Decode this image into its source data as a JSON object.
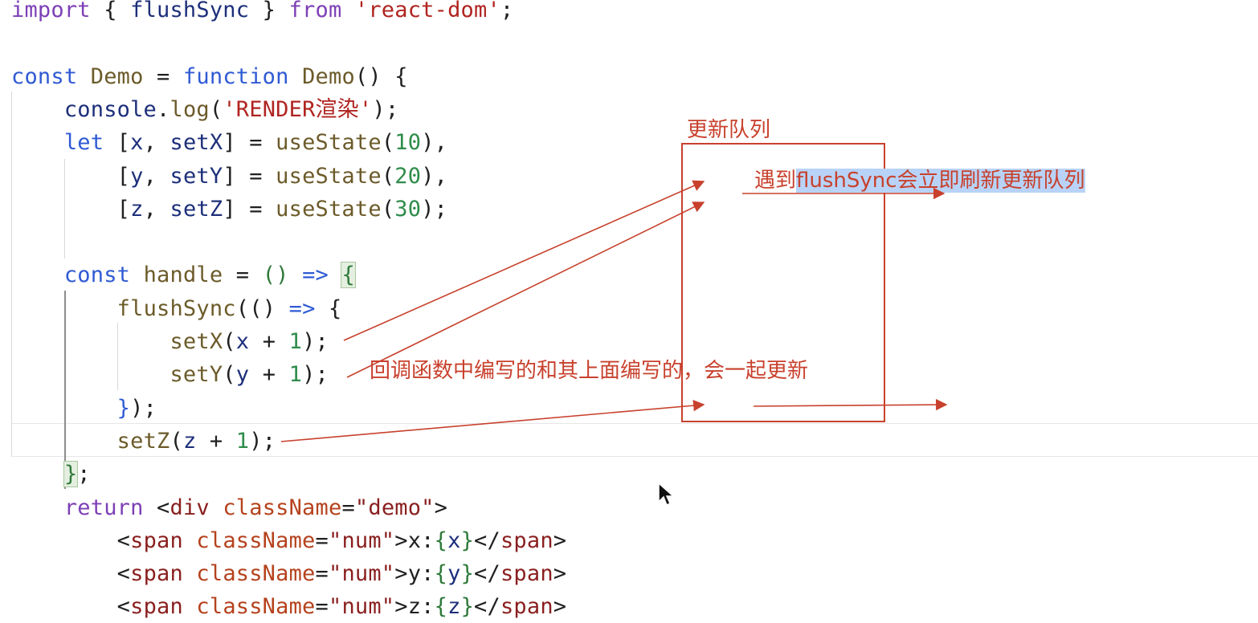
{
  "editor": {
    "lines": [
      {
        "tokens": [
          {
            "t": "import",
            "c": "kw2"
          },
          {
            "t": " { ",
            "c": "punc"
          },
          {
            "t": "flushSync",
            "c": "var"
          },
          {
            "t": " } ",
            "c": "punc"
          },
          {
            "t": "from",
            "c": "kw2"
          },
          {
            "t": " ",
            "c": "punc"
          },
          {
            "t": "'react-dom'",
            "c": "str"
          },
          {
            "t": ";",
            "c": "punc"
          }
        ]
      },
      {
        "tokens": []
      },
      {
        "tokens": [
          {
            "t": "const",
            "c": "kw"
          },
          {
            "t": " ",
            "c": "punc"
          },
          {
            "t": "Demo",
            "c": "fn"
          },
          {
            "t": " = ",
            "c": "punc"
          },
          {
            "t": "function",
            "c": "kw"
          },
          {
            "t": " ",
            "c": "punc"
          },
          {
            "t": "Demo",
            "c": "fn"
          },
          {
            "t": "() {",
            "c": "punc"
          }
        ]
      },
      {
        "tokens": [
          {
            "t": "    ",
            "c": "punc"
          },
          {
            "t": "console",
            "c": "var"
          },
          {
            "t": ".",
            "c": "punc"
          },
          {
            "t": "log",
            "c": "fn"
          },
          {
            "t": "(",
            "c": "punc"
          },
          {
            "t": "'RENDER渲染'",
            "c": "str"
          },
          {
            "t": ");",
            "c": "punc"
          }
        ]
      },
      {
        "tokens": [
          {
            "t": "    ",
            "c": "punc"
          },
          {
            "t": "let",
            "c": "kw"
          },
          {
            "t": " [",
            "c": "punc"
          },
          {
            "t": "x",
            "c": "var"
          },
          {
            "t": ", ",
            "c": "punc"
          },
          {
            "t": "setX",
            "c": "var"
          },
          {
            "t": "] = ",
            "c": "punc"
          },
          {
            "t": "useState",
            "c": "fn"
          },
          {
            "t": "(",
            "c": "punc"
          },
          {
            "t": "10",
            "c": "num"
          },
          {
            "t": "),",
            "c": "punc"
          }
        ]
      },
      {
        "tokens": [
          {
            "t": "        [",
            "c": "punc"
          },
          {
            "t": "y",
            "c": "var"
          },
          {
            "t": ", ",
            "c": "punc"
          },
          {
            "t": "setY",
            "c": "var"
          },
          {
            "t": "] = ",
            "c": "punc"
          },
          {
            "t": "useState",
            "c": "fn"
          },
          {
            "t": "(",
            "c": "punc"
          },
          {
            "t": "20",
            "c": "num"
          },
          {
            "t": "),",
            "c": "punc"
          }
        ]
      },
      {
        "tokens": [
          {
            "t": "        [",
            "c": "punc"
          },
          {
            "t": "z",
            "c": "var"
          },
          {
            "t": ", ",
            "c": "punc"
          },
          {
            "t": "setZ",
            "c": "var"
          },
          {
            "t": "] = ",
            "c": "punc"
          },
          {
            "t": "useState",
            "c": "fn"
          },
          {
            "t": "(",
            "c": "punc"
          },
          {
            "t": "30",
            "c": "num"
          },
          {
            "t": ");",
            "c": "punc"
          }
        ]
      },
      {
        "tokens": []
      },
      {
        "tokens": [
          {
            "t": "    ",
            "c": "punc"
          },
          {
            "t": "const",
            "c": "kw"
          },
          {
            "t": " ",
            "c": "punc"
          },
          {
            "t": "handle",
            "c": "fn"
          },
          {
            "t": " = ",
            "c": "punc"
          },
          {
            "t": "()",
            "c": "brk"
          },
          {
            "t": " ",
            "c": "punc"
          },
          {
            "t": "=>",
            "c": "kw"
          },
          {
            "t": " ",
            "c": "punc"
          },
          {
            "t": "{",
            "c": "brk bracehl"
          }
        ]
      },
      {
        "tokens": [
          {
            "t": "        ",
            "c": "punc"
          },
          {
            "t": "flushSync",
            "c": "fn"
          },
          {
            "t": "(",
            "c": "punc"
          },
          {
            "t": "()",
            "c": "punc"
          },
          {
            "t": " ",
            "c": "punc"
          },
          {
            "t": "=>",
            "c": "kw"
          },
          {
            "t": " {",
            "c": "punc"
          }
        ]
      },
      {
        "tokens": [
          {
            "t": "            ",
            "c": "punc"
          },
          {
            "t": "setX",
            "c": "fn"
          },
          {
            "t": "(",
            "c": "punc"
          },
          {
            "t": "x",
            "c": "var"
          },
          {
            "t": " + ",
            "c": "punc"
          },
          {
            "t": "1",
            "c": "num"
          },
          {
            "t": ");",
            "c": "punc"
          }
        ]
      },
      {
        "tokens": [
          {
            "t": "            ",
            "c": "punc"
          },
          {
            "t": "setY",
            "c": "fn"
          },
          {
            "t": "(",
            "c": "punc"
          },
          {
            "t": "y",
            "c": "var"
          },
          {
            "t": " + ",
            "c": "punc"
          },
          {
            "t": "1",
            "c": "num"
          },
          {
            "t": ");",
            "c": "punc"
          }
        ]
      },
      {
        "tokens": [
          {
            "t": "        ",
            "c": "punc"
          },
          {
            "t": "}",
            "c": "kw"
          },
          {
            "t": ");",
            "c": "punc"
          }
        ]
      },
      {
        "tokens": [
          {
            "t": "        ",
            "c": "punc"
          },
          {
            "t": "setZ",
            "c": "fn"
          },
          {
            "t": "(",
            "c": "punc"
          },
          {
            "t": "z",
            "c": "var"
          },
          {
            "t": " + ",
            "c": "punc"
          },
          {
            "t": "1",
            "c": "num"
          },
          {
            "t": ");",
            "c": "punc"
          }
        ]
      },
      {
        "tokens": [
          {
            "t": "    ",
            "c": "punc"
          },
          {
            "t": "}",
            "c": "brk bracehl"
          },
          {
            "t": ";",
            "c": "punc"
          }
        ]
      },
      {
        "tokens": [
          {
            "t": "    ",
            "c": "punc"
          },
          {
            "t": "return",
            "c": "kw2"
          },
          {
            "t": " <",
            "c": "punc"
          },
          {
            "t": "div",
            "c": "tag"
          },
          {
            "t": " ",
            "c": "punc"
          },
          {
            "t": "className",
            "c": "attr"
          },
          {
            "t": "=",
            "c": "punc"
          },
          {
            "t": "\"demo\"",
            "c": "tag"
          },
          {
            "t": ">",
            "c": "punc"
          }
        ]
      },
      {
        "tokens": [
          {
            "t": "        <",
            "c": "punc"
          },
          {
            "t": "span",
            "c": "tag"
          },
          {
            "t": " ",
            "c": "punc"
          },
          {
            "t": "className",
            "c": "attr"
          },
          {
            "t": "=",
            "c": "punc"
          },
          {
            "t": "\"num\"",
            "c": "tag"
          },
          {
            "t": ">x:",
            "c": "punc"
          },
          {
            "t": "{",
            "c": "brk"
          },
          {
            "t": "x",
            "c": "var"
          },
          {
            "t": "}",
            "c": "brk"
          },
          {
            "t": "</",
            "c": "punc"
          },
          {
            "t": "span",
            "c": "tag"
          },
          {
            "t": ">",
            "c": "punc"
          }
        ]
      },
      {
        "tokens": [
          {
            "t": "        <",
            "c": "punc"
          },
          {
            "t": "span",
            "c": "tag"
          },
          {
            "t": " ",
            "c": "punc"
          },
          {
            "t": "className",
            "c": "attr"
          },
          {
            "t": "=",
            "c": "punc"
          },
          {
            "t": "\"num\"",
            "c": "tag"
          },
          {
            "t": ">y:",
            "c": "punc"
          },
          {
            "t": "{",
            "c": "brk"
          },
          {
            "t": "y",
            "c": "var"
          },
          {
            "t": "}",
            "c": "brk"
          },
          {
            "t": "</",
            "c": "punc"
          },
          {
            "t": "span",
            "c": "tag"
          },
          {
            "t": ">",
            "c": "punc"
          }
        ]
      },
      {
        "tokens": [
          {
            "t": "        <",
            "c": "punc"
          },
          {
            "t": "span",
            "c": "tag"
          },
          {
            "t": " ",
            "c": "punc"
          },
          {
            "t": "className",
            "c": "attr"
          },
          {
            "t": "=",
            "c": "punc"
          },
          {
            "t": "\"num\"",
            "c": "tag"
          },
          {
            "t": ">z:",
            "c": "punc"
          },
          {
            "t": "{",
            "c": "brk"
          },
          {
            "t": "z",
            "c": "var"
          },
          {
            "t": "}",
            "c": "brk"
          },
          {
            "t": "</",
            "c": "punc"
          },
          {
            "t": "span",
            "c": "tag"
          },
          {
            "t": ">",
            "c": "punc"
          }
        ]
      }
    ]
  },
  "annotations": {
    "queue_label": "更新队列",
    "flush_note_prefix": "遇到",
    "flush_note_highlight": "flushSync会立即刷新更新队列",
    "callback_note": "回调函数中编写的和其上面编写的，会一起更新",
    "color": "#c8412d"
  },
  "icons": {
    "cursor": "mouse-pointer-icon"
  }
}
